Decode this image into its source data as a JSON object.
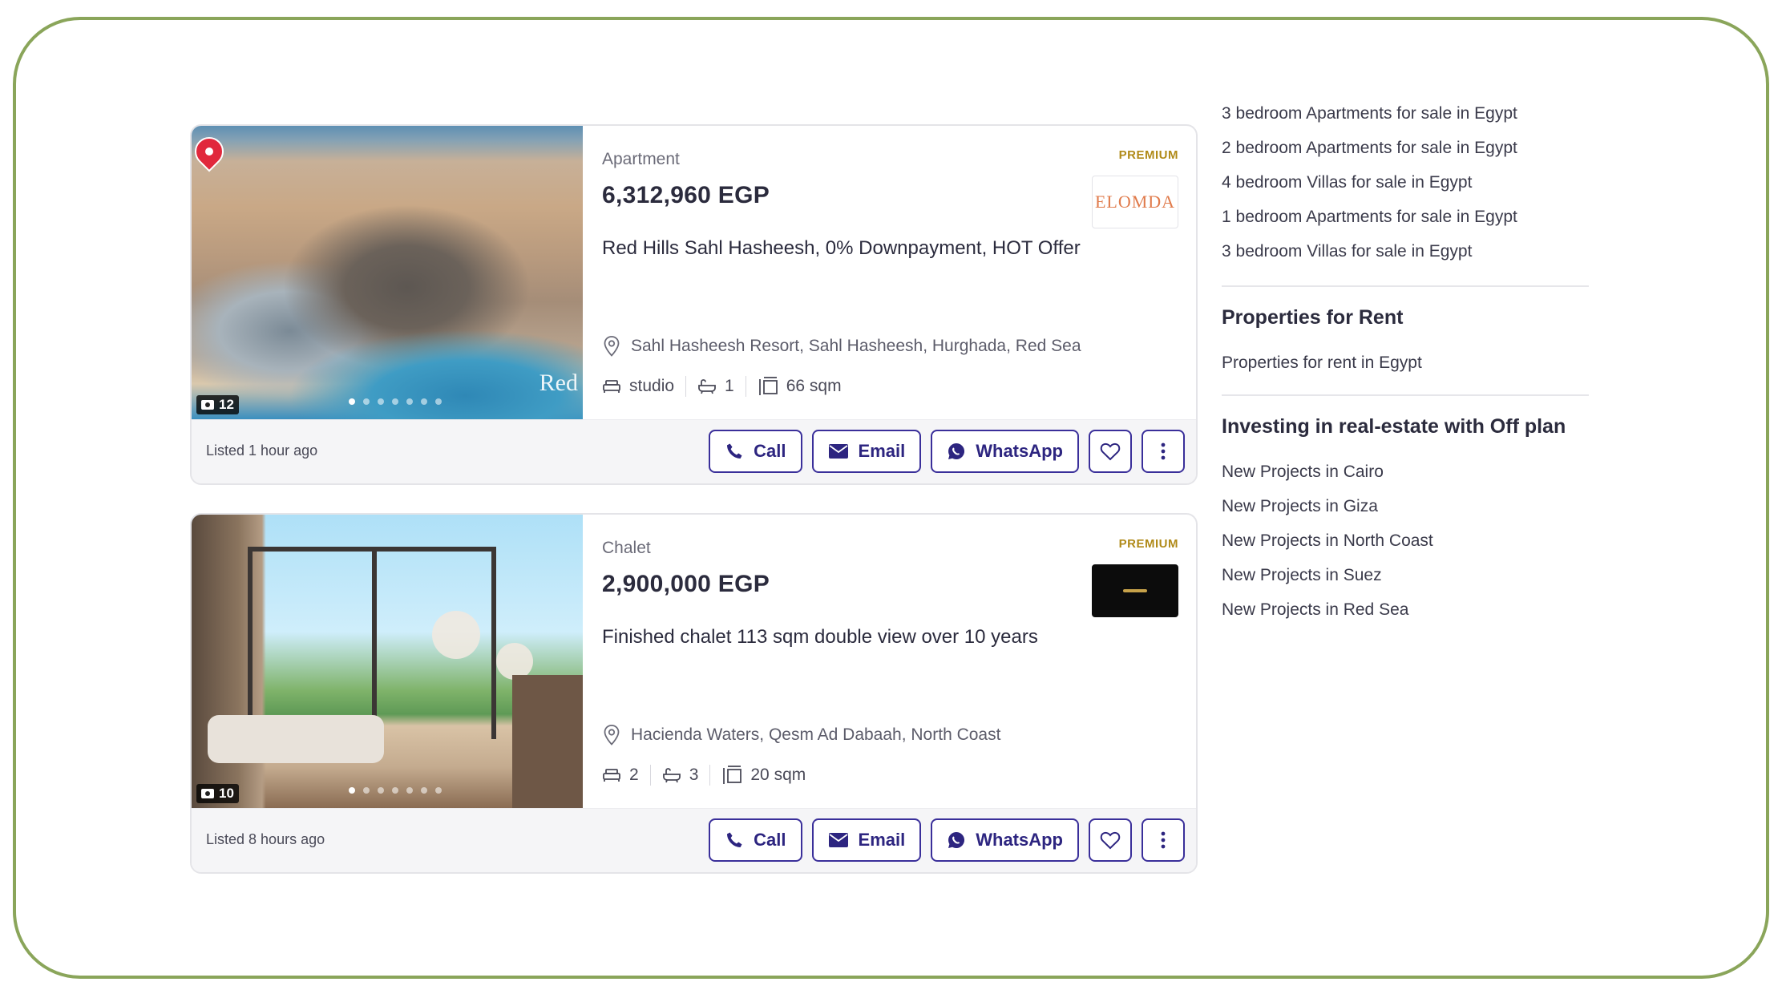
{
  "listings": [
    {
      "photo_count": "12",
      "photo_watermark": "Red",
      "type": "Apartment",
      "price": "6,312,960 EGP",
      "title": "Red Hills Sahl Hasheesh, 0% Downpayment, HOT Offer",
      "premium_label": "PREMIUM",
      "agency_logo_text": "ELOMDA",
      "location": "Sahl Hasheesh Resort, Sahl Hasheesh, Hurghada, Red Sea",
      "bedrooms": "studio",
      "bathrooms": "1",
      "area": "66 sqm",
      "listed": "Listed 1 hour ago",
      "actions": {
        "call": "Call",
        "email": "Email",
        "whatsapp": "WhatsApp"
      }
    },
    {
      "photo_count": "10",
      "type": "Chalet",
      "price": "2,900,000 EGP",
      "title": "Finished chalet 113 sqm double view over 10 years",
      "premium_label": "PREMIUM",
      "location": "Hacienda Waters, Qesm Ad Dabaah, North Coast",
      "bedrooms": "2",
      "bathrooms": "3",
      "area": "20 sqm",
      "listed": "Listed 8 hours ago",
      "actions": {
        "call": "Call",
        "email": "Email",
        "whatsapp": "WhatsApp"
      }
    }
  ],
  "sidebar": {
    "top_links": [
      "3 bedroom Apartments for sale in Egypt",
      "2 bedroom Apartments for sale in Egypt",
      "4 bedroom Villas for sale in Egypt",
      "1 bedroom Apartments for sale in Egypt",
      "3 bedroom Villas for sale in Egypt"
    ],
    "rent_heading": "Properties for Rent",
    "rent_links": [
      "Properties for rent in Egypt"
    ],
    "offplan_heading": "Investing in real-estate with Off plan",
    "offplan_links": [
      "New Projects in Cairo",
      "New Projects in Giza",
      "New Projects in North Coast",
      "New Projects in Suez",
      "New Projects in Red Sea"
    ]
  },
  "colors": {
    "frame_border": "#8aa55a",
    "button_border": "#3a2f9a",
    "button_text": "#2d2580",
    "premium": "#b08a18"
  }
}
